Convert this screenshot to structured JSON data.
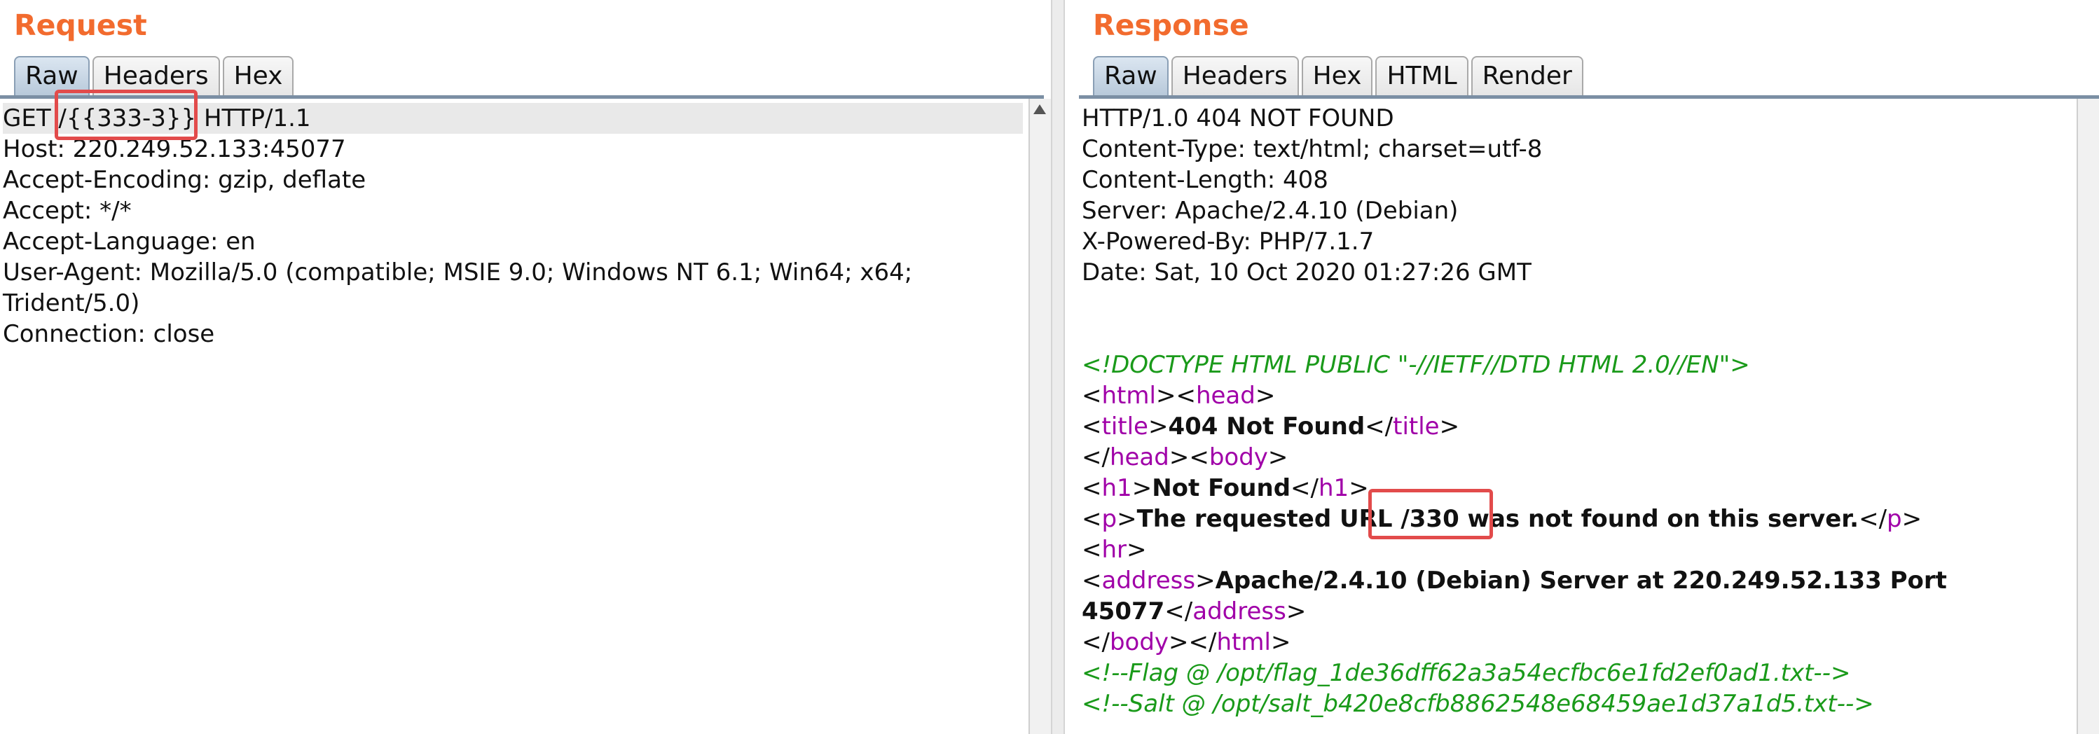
{
  "request": {
    "title": "Request",
    "tabs": [
      "Raw",
      "Headers",
      "Hex"
    ],
    "lines": [
      "GET /{{333-3}} HTTP/1.1",
      "Host: 220.249.52.133:45077",
      "Accept-Encoding: gzip, deflate",
      "Accept: */*",
      "Accept-Language: en",
      "User-Agent: Mozilla/5.0 (compatible; MSIE 9.0; Windows NT 6.1; Win64; x64;",
      "Trident/5.0)",
      "Connection: close"
    ]
  },
  "response": {
    "title": "Response",
    "tabs": [
      "Raw",
      "Headers",
      "Hex",
      "HTML",
      "Render"
    ],
    "headers": [
      "HTTP/1.0 404 NOT FOUND",
      "Content-Type: text/html; charset=utf-8",
      "Content-Length: 408",
      "Server: Apache/2.4.10 (Debian)",
      "X-Powered-By: PHP/7.1.7",
      "Date: Sat, 10 Oct 2020 01:27:26 GMT"
    ],
    "body": {
      "doctype": "<!DOCTYPE HTML PUBLIC \"-//IETF//DTD HTML 2.0//EN\">",
      "title_text": "404 Not Found",
      "h1_text": "Not Found",
      "p_text": "The requested URL /330 was not found on this server.",
      "address_text_1": "Apache/2.4.10 (Debian) Server at 220.249.52.133 Port",
      "address_text_2": "45077",
      "comment_flag": "<!--Flag @ /opt/flag_1de36dff62a3a54ecfbc6e1fd2ef0ad1.txt-->",
      "comment_salt": "<!--Salt @ /opt/salt_b420e8cfb8862548e68459ae1d37a1d5.txt-->"
    }
  },
  "colors": {
    "title": "#f26b2e",
    "tag": "#a000a8",
    "comment": "#1a9a1a",
    "callout": "#e24b4b"
  }
}
